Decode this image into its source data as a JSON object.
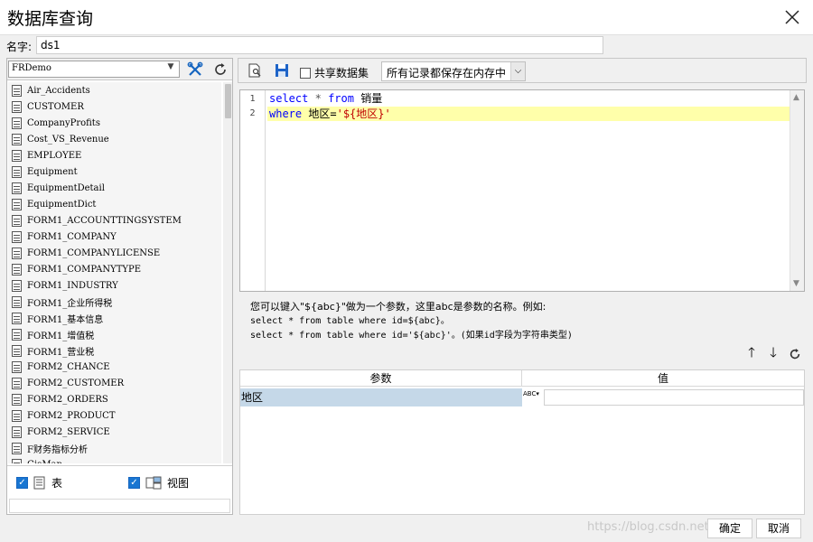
{
  "window": {
    "title": "数据库查询"
  },
  "name_field": {
    "label": "名字:",
    "value": "ds1"
  },
  "datasource": {
    "selected": "FRDemo"
  },
  "tables": [
    "Air_Accidents",
    "CUSTOMER",
    "CompanyProfits",
    "Cost_VS_Revenue",
    "EMPLOYEE",
    "Equipment",
    "EquipmentDetail",
    "EquipmentDict",
    "FORM1_ACCOUNTTINGSYSTEM",
    "FORM1_COMPANY",
    "FORM1_COMPANYLICENSE",
    "FORM1_COMPANYTYPE",
    "FORM1_INDUSTRY",
    "FORM1_企业所得税",
    "FORM1_基本信息",
    "FORM1_增值税",
    "FORM1_营业税",
    "FORM2_CHANCE",
    "FORM2_CUSTOMER",
    "FORM2_ORDERS",
    "FORM2_PRODUCT",
    "FORM2_SERVICE",
    "F财务指标分析",
    "GisMap"
  ],
  "filters": {
    "table_label": "表",
    "view_label": "视图"
  },
  "toolbar": {
    "share_label": "共享数据集",
    "memory_option": "所有记录都保存在内存中"
  },
  "sql": {
    "line_numbers": [
      "1",
      "2"
    ],
    "line1": {
      "kw1": "select",
      "star": "*",
      "kw2": "from",
      "table": "销量"
    },
    "line2": {
      "kw": "where",
      "field": "地区=",
      "str": "'${地区}'"
    }
  },
  "hint": {
    "line1": "您可以键入\"${abc}\"做为一个参数，这里abc是参数的名称。例如:",
    "line2": "select * from table where id=${abc}。",
    "line3": "select * from table where id='${abc}'。(如果id字段为字符串类型)"
  },
  "params": {
    "col_name": "参数",
    "col_value": "值",
    "rows": [
      {
        "name": "地区",
        "type_icon": "ABC",
        "value": ""
      }
    ]
  },
  "buttons": {
    "ok": "确定",
    "cancel": "取消"
  },
  "watermark": "https://blog.csdn.net/weixin"
}
